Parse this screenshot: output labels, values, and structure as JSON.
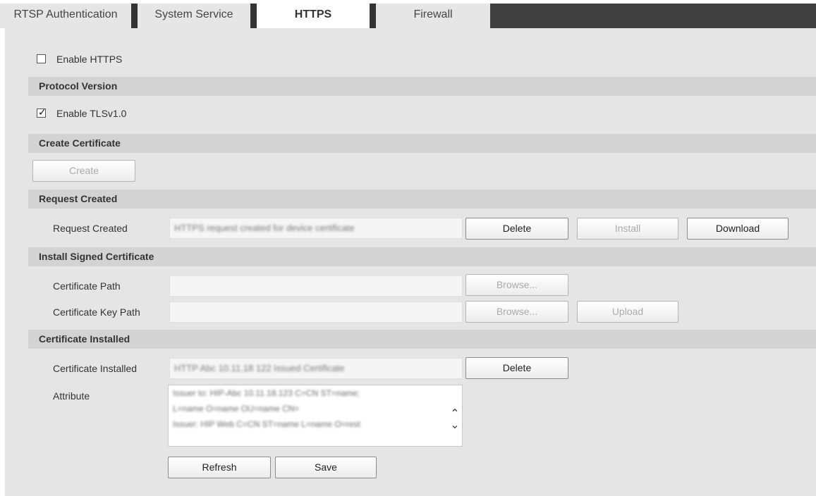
{
  "tabs": [
    {
      "label": "RTSP Authentication"
    },
    {
      "label": "System Service"
    },
    {
      "label": "HTTPS"
    },
    {
      "label": "Firewall"
    }
  ],
  "enable_https": {
    "label": "Enable HTTPS",
    "checked": false
  },
  "protocol_version": {
    "title": "Protocol Version",
    "tls_label": "Enable TLSv1.0",
    "tls_checked": true
  },
  "create_certificate": {
    "title": "Create Certificate",
    "create_button": "Create"
  },
  "request_created": {
    "title": "Request Created",
    "row_label": "Request Created",
    "value": "HTTPS request created for device certificate",
    "delete_button": "Delete",
    "install_button": "Install",
    "download_button": "Download"
  },
  "install_signed": {
    "title": "Install Signed Certificate",
    "cert_path_label": "Certificate Path",
    "cert_key_path_label": "Certificate Key Path",
    "browse_button": "Browse...",
    "browse_key_button": "Browse...",
    "upload_button": "Upload"
  },
  "certificate_installed": {
    "title": "Certificate Installed",
    "row_label": "Certificate Installed",
    "value": "HTTP Abc 10.11.18 122 Issued Certificate",
    "delete_button": "Delete",
    "attribute_label": "Attribute",
    "attribute_lines": [
      "Issuer to: HIP-Abc 10.11.18.123 C=CN ST=name;",
      "L=name O=name OU=name CN=",
      "Issuer: HIP Web C=CN ST=name L=name O=rest"
    ]
  },
  "footer": {
    "refresh_button": "Refresh",
    "save_button": "Save"
  },
  "icons": {
    "scroll_up": "chevron-up-icon",
    "scroll_down": "chevron-down-icon"
  }
}
